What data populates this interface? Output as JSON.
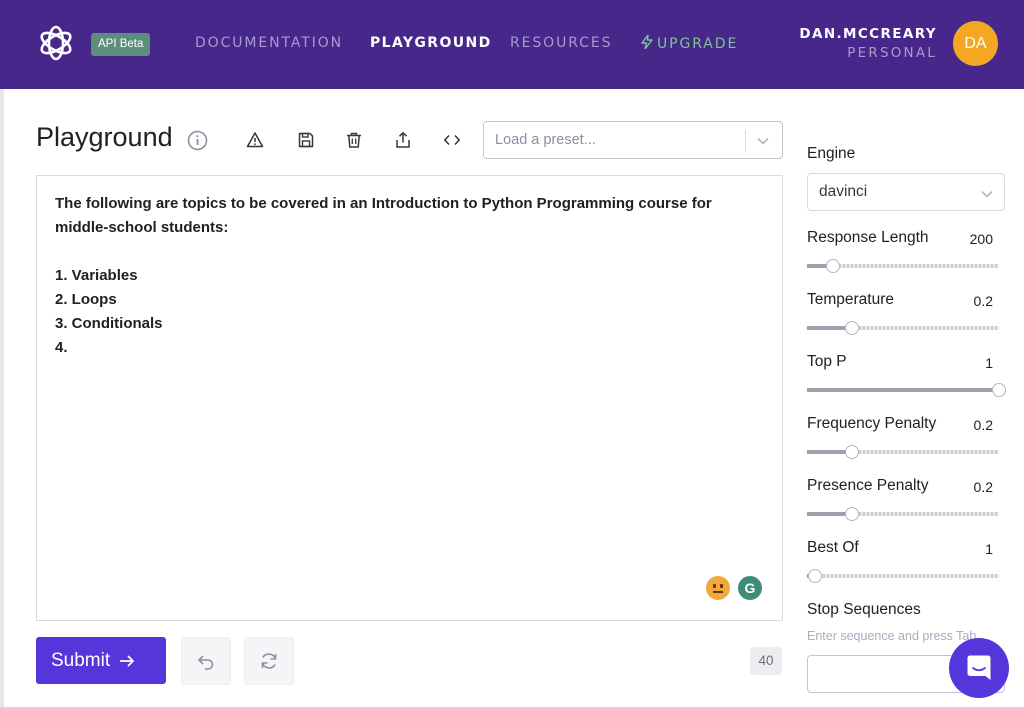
{
  "nav": {
    "beta_badge": "API Beta",
    "links": [
      "DOCUMENTATION",
      "PLAYGROUND",
      "RESOURCES",
      "UPGRADE"
    ],
    "user_name": "DAN.MCCREARY",
    "user_org": "PERSONAL",
    "avatar_initials": "DA"
  },
  "page": {
    "title": "Playground",
    "preset_placeholder": "Load a preset..."
  },
  "editor": {
    "prompt": "The following are topics to be covered in an Introduction to Python Programming course for middle-school students:\n\n1. Variables\n2. Loops\n3. Conditionals\n4."
  },
  "actions": {
    "submit_label": "Submit",
    "token_count": "40"
  },
  "settings": {
    "engine_label": "Engine",
    "engine_value": "davinci",
    "params": [
      {
        "label": "Response Length",
        "value": "200",
        "level": 0.1
      },
      {
        "label": "Temperature",
        "value": "0.2",
        "level": 0.2
      },
      {
        "label": "Top P",
        "value": "1",
        "level": 1.0
      },
      {
        "label": "Frequency Penalty",
        "value": "0.2",
        "level": 0.2
      },
      {
        "label": "Presence Penalty",
        "value": "0.2",
        "level": 0.2
      },
      {
        "label": "Best Of",
        "value": "1",
        "level": 0.0
      }
    ],
    "stop_label": "Stop Sequences",
    "stop_placeholder": "Enter sequence and press Tab"
  },
  "colors": {
    "nav_bg": "#47278a",
    "accent": "#5436da",
    "avatar": "#f5a623",
    "upgrade": "#7bc59a"
  }
}
